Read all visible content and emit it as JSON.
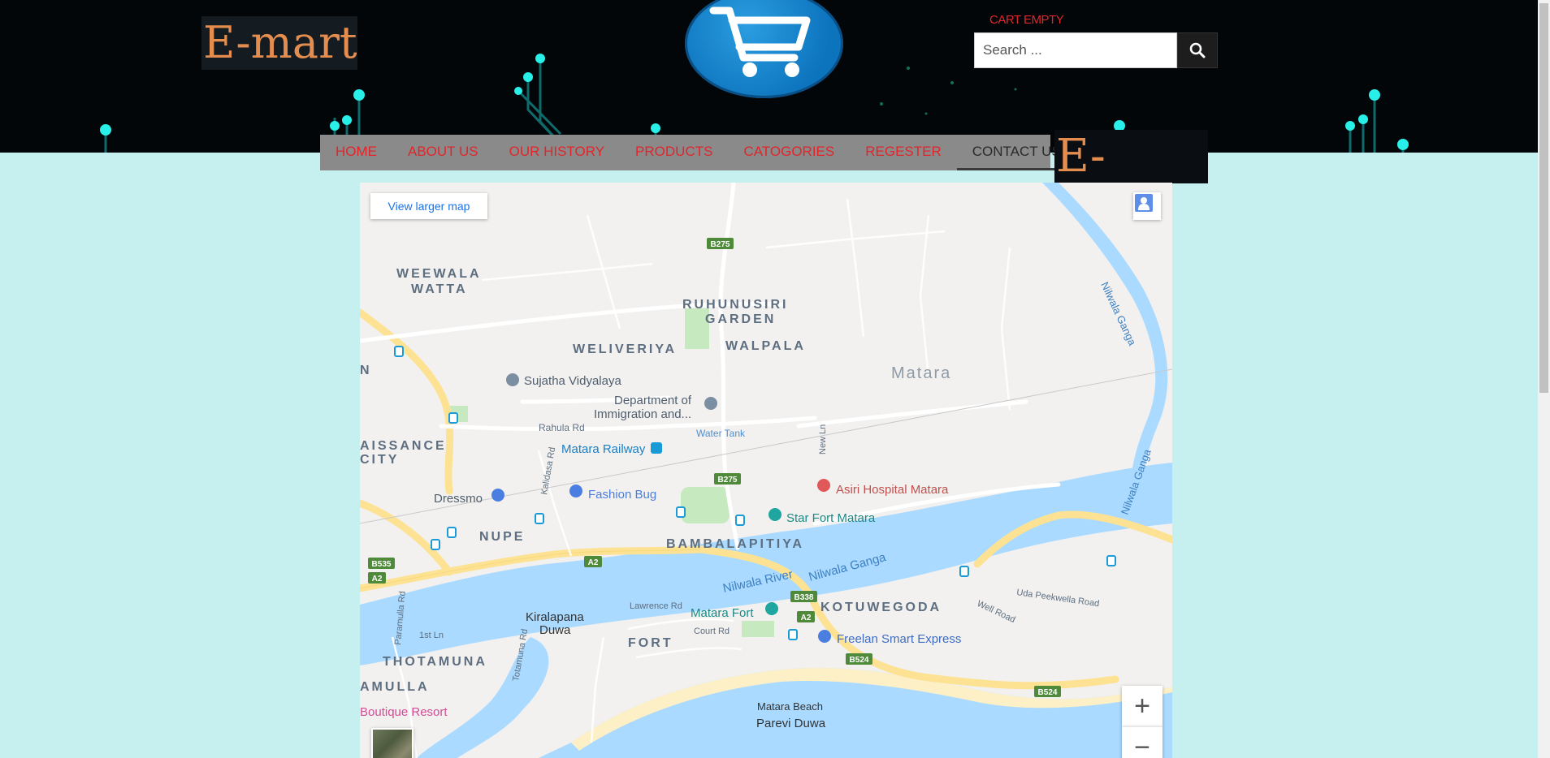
{
  "header": {
    "logo_text": "E-mart",
    "cart_status": "CART EMPTY",
    "search_placeholder": "Search ...",
    "secondary_logo_text": "E-mart"
  },
  "nav": {
    "items": [
      "HOME",
      "ABOUT US",
      "OUR HISTORY",
      "PRODUCTS",
      "CATOGORIES",
      "REGESTER",
      "CONTACT US"
    ],
    "active": "CONTACT US"
  },
  "map": {
    "view_larger_label": "View larger map",
    "zoom_in_label": "+",
    "zoom_out_label": "−",
    "areas": [
      "WEEWALA",
      "WATTA",
      "RUHUNUSIRI",
      "GARDEN",
      "WELIVERIYA",
      "WALPALA",
      "Matara",
      "AISSANCE",
      "CITY",
      "NUPE",
      "BAMBALAPITIYA",
      "KOTUWEGODA",
      "THOTAMUNA",
      "AMULLA",
      "FORT",
      "N"
    ],
    "places": [
      "Sujatha Vidyalaya",
      "Department of",
      "Immigration and...",
      "Water Tank",
      "Matara Railway",
      "Dressmo",
      "Fashion Bug",
      "Asiri Hospital Matara",
      "Star Fort Matara",
      "Matara Fort",
      "Freelan Smart Express",
      "Matara Beach",
      "Parevi Duwa",
      "Kiralapana",
      "Duwa",
      "Boutique Resort"
    ],
    "roads": [
      "Rahula Rd",
      "Kalidasa Rd",
      "New Ln",
      "Lawrence Rd",
      "Court Rd",
      "1st Ln",
      "Paramulla Rd",
      "Totamuna Rd",
      "Well Road",
      "Uda Peekwella Road"
    ],
    "water": [
      "Nilwala River",
      "Nilwala Ganga",
      "Nilwala Ganga",
      "Nilwala Ganga"
    ],
    "route_shields": [
      "B275",
      "B275",
      "B535",
      "A2",
      "A2",
      "B338",
      "A2",
      "B524",
      "B524"
    ]
  }
}
